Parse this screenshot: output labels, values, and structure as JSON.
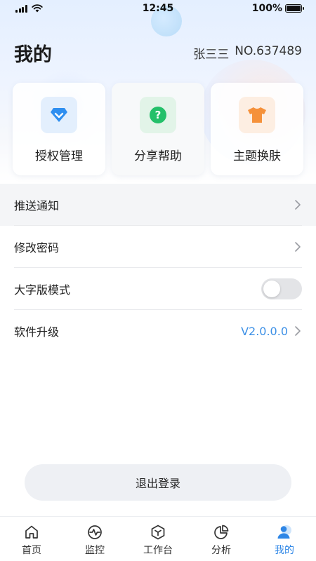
{
  "status_bar": {
    "time": "12:45",
    "battery": "100%"
  },
  "header": {
    "title": "我的",
    "user_name": "张三三",
    "user_no": "NO.637489"
  },
  "cards": [
    {
      "label": "授权管理",
      "icon": "diamond-icon",
      "color": "#2f8ff0",
      "bg": "#e3effd"
    },
    {
      "label": "分享帮助",
      "icon": "question-icon",
      "color": "#24c06a",
      "bg": "#e2f4e8"
    },
    {
      "label": "主题换肤",
      "icon": "tshirt-icon",
      "color": "#f5913a",
      "bg": "#fdeee2"
    }
  ],
  "menu": {
    "push": {
      "label": "推送通知"
    },
    "password": {
      "label": "修改密码"
    },
    "large_font": {
      "label": "大字版模式",
      "enabled": false
    },
    "upgrade": {
      "label": "软件升级",
      "version": "V2.0.0.0"
    }
  },
  "logout_label": "退出登录",
  "tabs": [
    {
      "label": "首页",
      "icon": "home-icon"
    },
    {
      "label": "监控",
      "icon": "pulse-icon"
    },
    {
      "label": "工作台",
      "icon": "cube-icon"
    },
    {
      "label": "分析",
      "icon": "pie-chart-icon"
    },
    {
      "label": "我的",
      "icon": "user-icon",
      "active": true
    }
  ],
  "colors": {
    "accent": "#2e86e6",
    "version_text": "#3b8fe6"
  }
}
